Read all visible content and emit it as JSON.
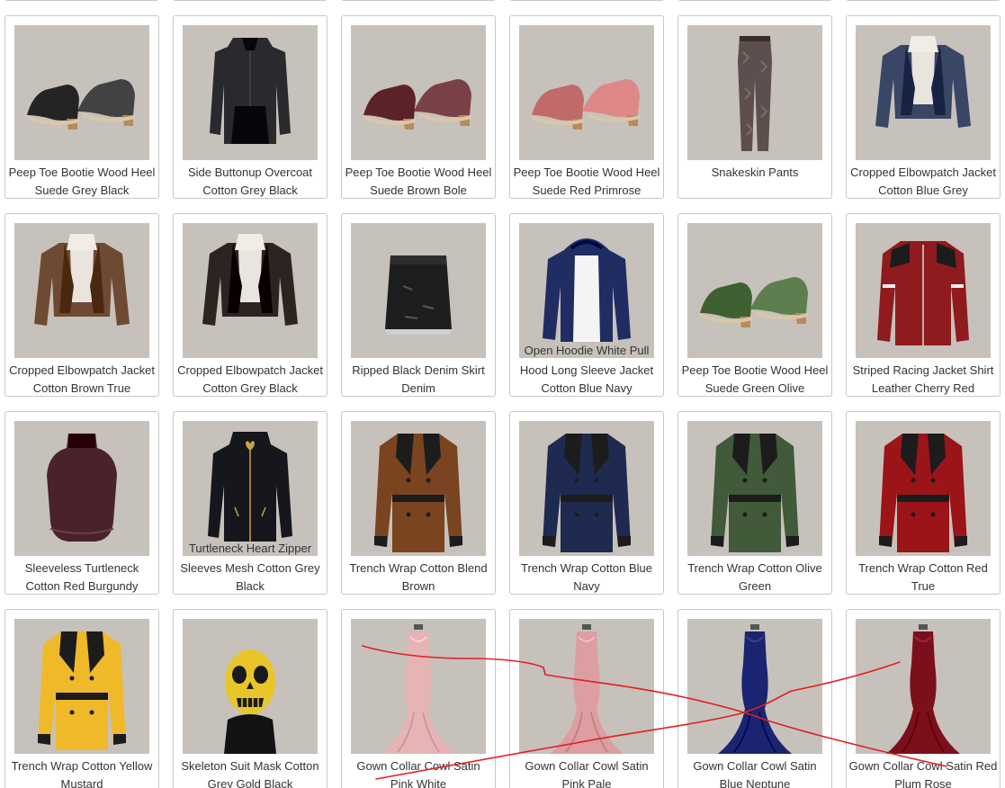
{
  "grid": {
    "items": [
      {
        "title": "Peep Toe Bootie Wood Heel Suede Grey Black",
        "icon": "shoe-icon",
        "color": "#242424"
      },
      {
        "title": "Side Buttonup Overcoat Cotton Grey Black",
        "icon": "coat-icon",
        "color": "#2a2a2e"
      },
      {
        "title": "Peep Toe Bootie Wood Heel Suede Brown Bole",
        "icon": "shoe-icon",
        "color": "#5b2328"
      },
      {
        "title": "Peep Toe Bootie Wood Heel Suede Red Primrose",
        "icon": "shoe-icon",
        "color": "#c06a6a"
      },
      {
        "title": "Snakeskin Pants",
        "icon": "pants-icon",
        "color": "#5c4f4d"
      },
      {
        "title": "Cropped Elbowpatch Jacket Cotton Blue Grey",
        "icon": "jacket-icon",
        "color": "#3a4666"
      },
      {
        "title": "Cropped Elbowpatch Jacket Cotton Brown True",
        "icon": "jacket-icon",
        "color": "#6f4a33"
      },
      {
        "title": "Cropped Elbowpatch Jacket Cotton Grey Black",
        "icon": "jacket-icon",
        "color": "#2b2420"
      },
      {
        "title": "Ripped Black Denim Skirt Denim",
        "icon": "skirt-icon",
        "color": "#1e1e1e"
      },
      {
        "title": "Hood Long Sleeve Jacket Cotton Blue Navy",
        "overlay": "Open Hoodie White Pull",
        "icon": "hoodie-icon",
        "color": "#1f2d63"
      },
      {
        "title": "Peep Toe Bootie Wood Heel Suede Green Olive",
        "icon": "shoe-icon",
        "color": "#3f6131"
      },
      {
        "title": "Striped Racing Jacket Shirt Leather Cherry Red",
        "icon": "racing-jacket-icon",
        "color": "#8f1b1f"
      },
      {
        "title": "Sleeveless Turtleneck Cotton Red Burgundy",
        "icon": "top-icon",
        "color": "#4a222a"
      },
      {
        "title": "Sleeves Mesh Cotton Grey Black",
        "overlay": "Turtleneck Heart Zipper",
        "icon": "zip-coat-icon",
        "color": "#16171c"
      },
      {
        "title": "Trench Wrap Cotton Blend Brown",
        "icon": "trench-icon",
        "color": "#7a4420"
      },
      {
        "title": "Trench Wrap Cotton Blue Navy",
        "icon": "trench-icon",
        "color": "#1e2a4f"
      },
      {
        "title": "Trench Wrap Cotton Olive Green",
        "icon": "trench-icon",
        "color": "#415a3a"
      },
      {
        "title": "Trench Wrap Cotton Red True",
        "icon": "trench-icon",
        "color": "#9b1418"
      },
      {
        "title": "Trench Wrap Cotton Yellow Mustard",
        "icon": "trench-icon",
        "color": "#f0b92a"
      },
      {
        "title": "Skeleton Suit Mask Cotton Grey Gold Black",
        "icon": "skull-mask-icon",
        "color": "#e8c62a"
      },
      {
        "title": "Gown Collar Cowl Satin Pink White",
        "icon": "gown-icon",
        "color": "#e6b4b4"
      },
      {
        "title": "Gown Collar Cowl Satin Pink Pale",
        "icon": "gown-icon",
        "color": "#dc9ea0"
      },
      {
        "title": "Gown Collar Cowl Satin Blue Neptune",
        "icon": "gown-icon",
        "color": "#1b2470"
      },
      {
        "title": "Gown Collar Cowl Satin Red Plum Rose",
        "icon": "gown-icon",
        "color": "#7c0f1c"
      }
    ]
  },
  "annotation": {
    "color": "#e02020"
  }
}
